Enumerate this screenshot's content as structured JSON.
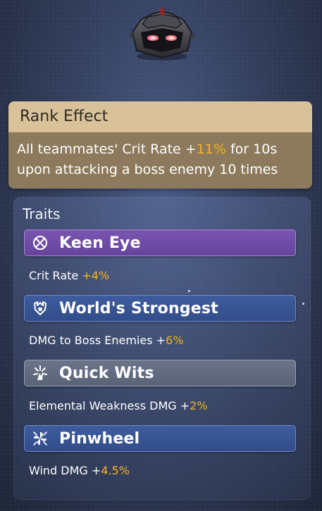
{
  "rank_effect": {
    "title": "Rank Effect",
    "line1_pre": "All teammates' Crit Rate +",
    "line1_value": "11%",
    "line1_post": " for 10s",
    "line2": "upon attacking a boss enemy 10 times"
  },
  "traits": {
    "title": "Traits",
    "items": [
      {
        "name": "Keen Eye",
        "icon": "crosshair-icon",
        "tier": "purple",
        "stat_label": "Crit Rate ",
        "stat_value": "+4%"
      },
      {
        "name": "World's Strongest",
        "icon": "fist-emblem-icon",
        "tier": "blue",
        "stat_label": "DMG to Boss Enemies +",
        "stat_value": "6%"
      },
      {
        "name": "Quick Wits",
        "icon": "spark-burst-icon",
        "tier": "gray",
        "stat_label": "Elemental Weakness DMG +",
        "stat_value": "2%"
      },
      {
        "name": "Pinwheel",
        "icon": "pinwheel-icon",
        "tier": "blue",
        "stat_label": "Wind DMG +",
        "stat_value": "4.5%"
      }
    ]
  },
  "colors": {
    "highlight": "#f4b323",
    "rank_header": "#d9c29a",
    "rank_body": "#8d7a5c",
    "purple_tier": "#7a55b0",
    "blue_tier": "#3e5c9e",
    "gray_tier": "#6c7489"
  }
}
